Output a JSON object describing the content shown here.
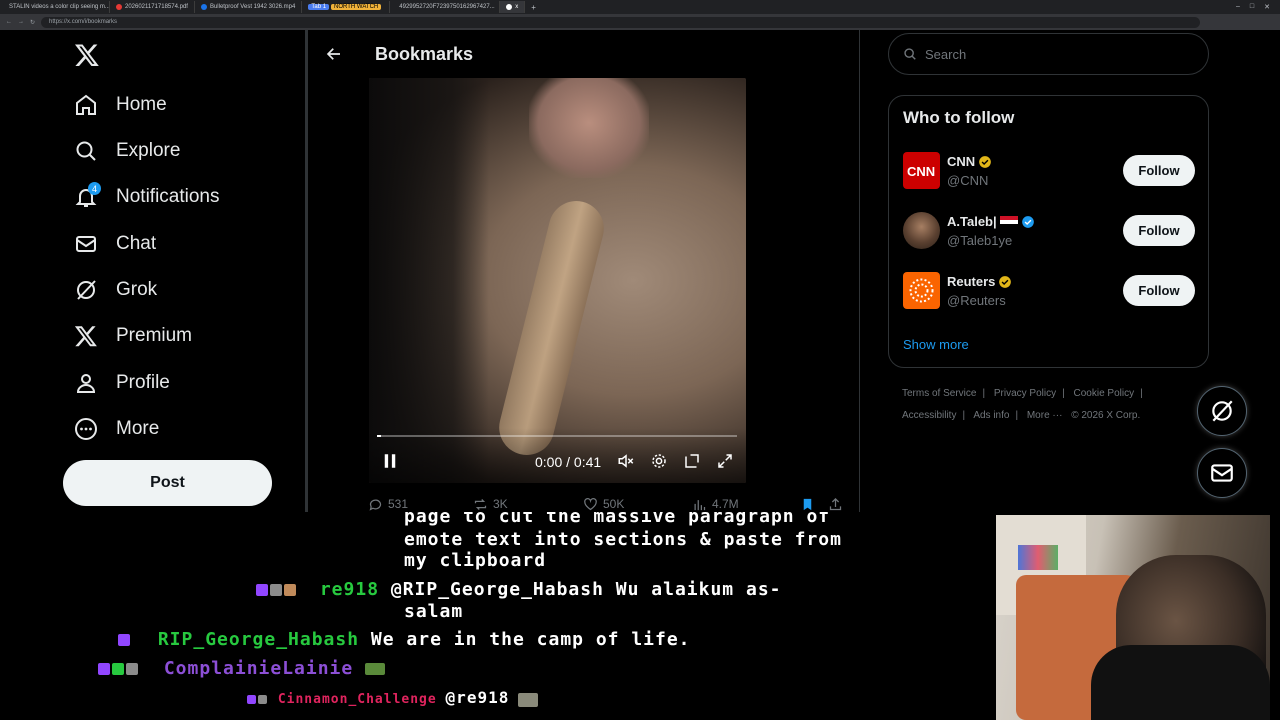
{
  "browser": {
    "tabs": [
      "STALIN videos a color clip seeing m...",
      "2026021171718574.pdf",
      "Bulletproof Vest 1942 3026.mp4",
      "4929952720F7239750162967427...",
      "x"
    ],
    "tab_chips": [
      "Tab 1",
      "NORTH WATCH"
    ],
    "url": "https://x.com/i/bookmarks"
  },
  "nav": {
    "items": [
      {
        "label": "Home",
        "icon": "home-icon"
      },
      {
        "label": "Explore",
        "icon": "search-icon"
      },
      {
        "label": "Notifications",
        "icon": "bell-icon",
        "badge": "4"
      },
      {
        "label": "Chat",
        "icon": "mail-icon"
      },
      {
        "label": "Grok",
        "icon": "grok-icon"
      },
      {
        "label": "Premium",
        "icon": "x-logo-icon"
      },
      {
        "label": "Profile",
        "icon": "person-icon"
      },
      {
        "label": "More",
        "icon": "more-circle-icon"
      }
    ],
    "post_label": "Post"
  },
  "center": {
    "title": "Bookmarks",
    "video": {
      "time": "0:00 / 0:41",
      "progress": 0.0
    },
    "actions": {
      "replies": "531",
      "reposts": "3K",
      "likes": "50K",
      "views": "4.7M"
    }
  },
  "right": {
    "search_placeholder": "Search",
    "who_to_follow": {
      "title": "Who to follow",
      "accounts": [
        {
          "name": "CNN",
          "handle": "@CNN",
          "verified_color": "#e2b719",
          "follow": "Follow"
        },
        {
          "name": "A.Taleb|",
          "handle": "@Taleb1ye",
          "verified_color": "#1d9bf0",
          "follow": "Follow"
        },
        {
          "name": "Reuters",
          "handle": "@Reuters",
          "verified_color": "#e2b719",
          "follow": "Follow"
        }
      ],
      "show_more": "Show more"
    },
    "footer": [
      "Terms of Service",
      "|",
      "Privacy Policy",
      "|",
      "Cookie Policy",
      "|",
      "Accessibility",
      "|",
      "Ads info",
      "|",
      "More ···",
      "© 2026 X Corp."
    ]
  },
  "chat": {
    "lines": [
      {
        "user": "",
        "text": "page to cut the massive paragraph of"
      },
      {
        "user": "",
        "text": "emote text into sections & paste from"
      },
      {
        "user": "",
        "text": "my clipboard"
      },
      {
        "user": "re918",
        "user_color": "#27c93f",
        "text": "@RIP_George_Habash Wu alaikum as-"
      },
      {
        "user": "",
        "text": "salam"
      },
      {
        "user": "RIP_George_Habash",
        "user_color": "#27c93f",
        "text": "We are in the camp of life."
      },
      {
        "user": "ComplainieLainie",
        "user_color": "#8c4fd6",
        "text": ""
      },
      {
        "user": "Cinnamon_Challenge",
        "user_color": "#e0245e",
        "text": "@re918"
      }
    ]
  }
}
